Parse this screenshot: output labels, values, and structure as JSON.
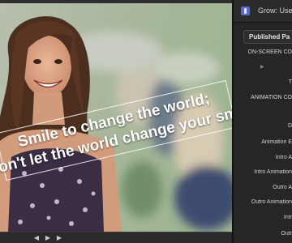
{
  "inspector": {
    "title": "Grow: Use",
    "tab_label": "Published Pa",
    "params": [
      {
        "label": "ON-SCREEN CO"
      },
      {
        "label": "T"
      },
      {
        "label": "ANIMATION CO"
      },
      {
        "label": "D"
      },
      {
        "label": "Animation E"
      },
      {
        "label": "Intro A"
      },
      {
        "label": "Intro Animation"
      },
      {
        "label": "Outro A"
      },
      {
        "label": "Outro Animation"
      },
      {
        "label": "Intr"
      },
      {
        "label": "Outr"
      }
    ],
    "disclosure_glyph": "▶"
  },
  "viewer": {
    "overlay_lines": [
      "Smile to change the world;",
      "Don't let the world change your smile."
    ]
  },
  "transport": {
    "prev": "◀",
    "play": "▶",
    "next": "▶"
  },
  "colors": {
    "background": "#1e1e1e",
    "panel": "#262626",
    "accent_icon": "#5a69c9",
    "text": "#cfcfcf"
  }
}
